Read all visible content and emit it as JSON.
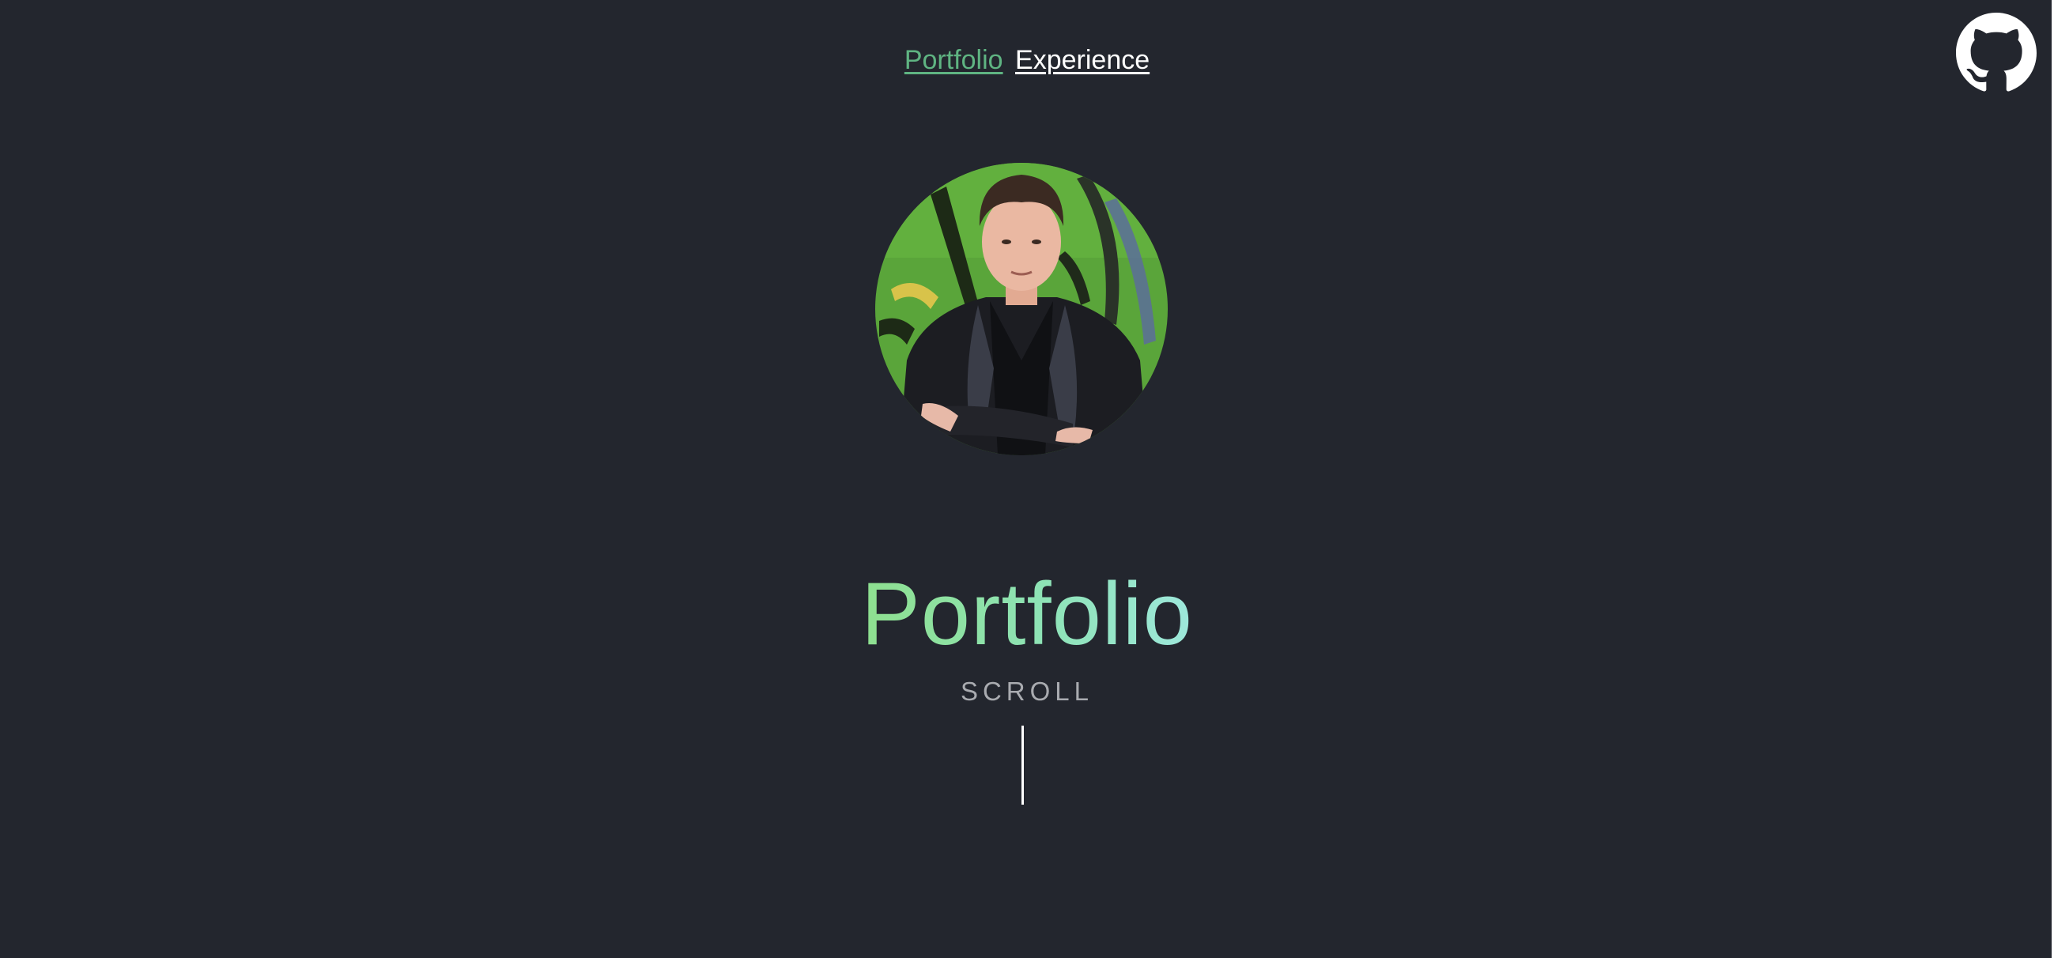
{
  "nav": {
    "portfolio_label": "Portfolio",
    "experience_label": "Experience"
  },
  "hero": {
    "title": "Portfolio",
    "scroll_label": "SCROLL"
  },
  "icons": {
    "github": "github-icon"
  },
  "colors": {
    "background": "#23262e",
    "nav_active": "#5fb482",
    "nav_inactive": "#ffffff",
    "title_gradient_start": "#8ee08f",
    "title_gradient_end": "#9ee8dc",
    "scroll_text": "#a9abb0"
  }
}
